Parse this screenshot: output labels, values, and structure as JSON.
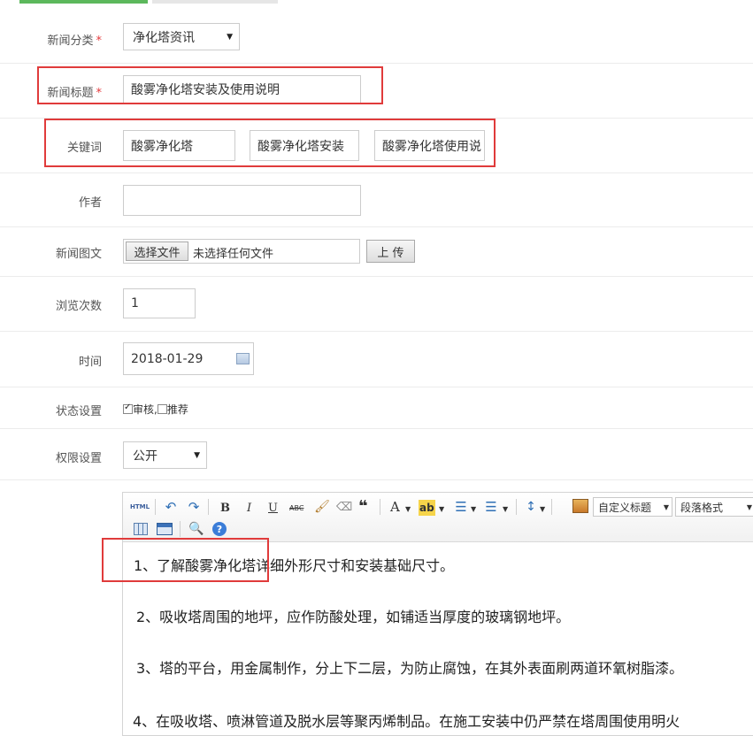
{
  "form": {
    "category": {
      "label": "新闻分类",
      "required": "*",
      "value": "净化塔资讯"
    },
    "title": {
      "label": "新闻标题",
      "required": "*",
      "value": "酸雾净化塔安装及使用说明"
    },
    "keywords": {
      "label": "关键词",
      "values": [
        "酸雾净化塔",
        "酸雾净化塔安装",
        "酸雾净化塔使用说"
      ]
    },
    "author": {
      "label": "作者",
      "value": ""
    },
    "image": {
      "label": "新闻图文",
      "choose_label": "选择文件",
      "no_file_text": "未选择任何文件",
      "upload_label": "上 传"
    },
    "views": {
      "label": "浏览次数",
      "value": "1"
    },
    "time": {
      "label": "时间",
      "value": "2018-01-29"
    },
    "status": {
      "label": "状态设置",
      "review_label": "审核",
      "review_checked": true,
      "separator": ",",
      "recommend_label": "推荐",
      "recommend_checked": false
    },
    "permission": {
      "label": "权限设置",
      "value": "公开"
    }
  },
  "editor": {
    "toolbar": {
      "html_label": "HTML",
      "bold": "B",
      "italic": "I",
      "underline": "U",
      "strike": "ABC",
      "quote": "❝",
      "font_color": "A",
      "highlight": "ab",
      "custom_heading": "自定义标题",
      "paragraph_format": "段落格式"
    },
    "paragraphs": [
      "1、了解酸雾净化塔详细外形尺寸和安装基础尺寸。",
      "2、吸收塔周围的地坪，应作防酸处理，如铺适当厚度的玻璃钢地坪。",
      "3、塔的平台，用金属制作，分上下二层，为防止腐蚀，在其外表面刷两道环氧树脂漆。",
      "4、在吸收塔、喷淋管道及脱水层等聚丙烯制品。在施工安装中仍严禁在塔周围使用明火"
    ]
  },
  "colors": {
    "accent_green": "#5cb85c",
    "highlight_red": "#e03b3b",
    "border": "#cccccc"
  }
}
